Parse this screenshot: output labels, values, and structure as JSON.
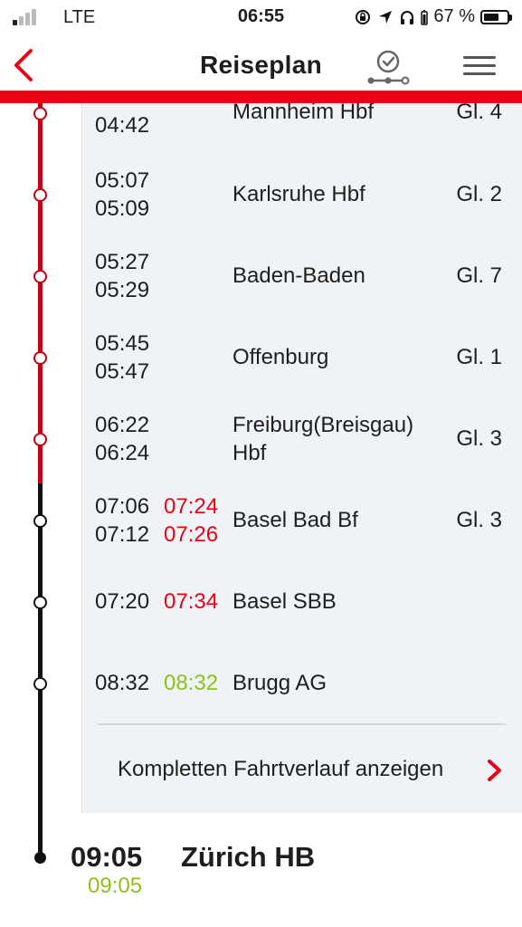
{
  "status_bar": {
    "carrier": "LTE",
    "time": "06:55",
    "battery_percent": "67 %",
    "battery_level": 0.67
  },
  "nav": {
    "title": "Reiseplan",
    "back_icon": "chevron-left-icon",
    "realtime_icon": "clock-route-icon",
    "menu_icon": "hamburger-icon"
  },
  "colors": {
    "accent_red": "#ec0016",
    "ontime_green": "#8fbf1f",
    "track_red": "#c00010",
    "track_black": "#111111"
  },
  "stops": [
    {
      "arr": "",
      "dep": "04:42",
      "delay_arr": "",
      "delay_dep": "",
      "station": "Mannheim Hbf",
      "station2": "",
      "platform": "Gl. 4"
    },
    {
      "arr": "05:07",
      "dep": "05:09",
      "delay_arr": "",
      "delay_dep": "",
      "station": "Karlsruhe Hbf",
      "station2": "",
      "platform": "Gl. 2"
    },
    {
      "arr": "05:27",
      "dep": "05:29",
      "delay_arr": "",
      "delay_dep": "",
      "station": "Baden-Baden",
      "station2": "",
      "platform": "Gl. 7"
    },
    {
      "arr": "05:45",
      "dep": "05:47",
      "delay_arr": "",
      "delay_dep": "",
      "station": "Offenburg",
      "station2": "",
      "platform": "Gl. 1"
    },
    {
      "arr": "06:22",
      "dep": "06:24",
      "delay_arr": "",
      "delay_dep": "",
      "station": "Freiburg(Breisgau)",
      "station2": "Hbf",
      "platform": "Gl. 3"
    },
    {
      "arr": "07:06",
      "dep": "07:12",
      "delay_arr": "07:24",
      "delay_dep": "07:26",
      "station": "Basel Bad Bf",
      "station2": "",
      "platform": "Gl. 3"
    },
    {
      "arr": "07:20",
      "dep": "",
      "delay_arr": "07:34",
      "delay_dep": "",
      "station": "Basel SBB",
      "station2": "",
      "platform": ""
    },
    {
      "arr": "08:32",
      "dep": "",
      "delay_arr": "08:32",
      "delay_dep": "",
      "station": "Brugg AG",
      "station2": "",
      "platform": ""
    }
  ],
  "route_link": "Kompletten Fahrtverlauf anzeigen",
  "destination": {
    "time": "09:05",
    "actual_time": "09:05",
    "station": "Zürich HB"
  }
}
